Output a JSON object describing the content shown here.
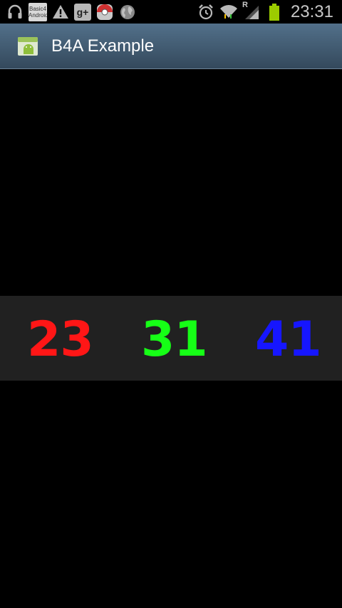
{
  "status_bar": {
    "time": "23:31",
    "notification_icons": [
      "headphones-icon",
      "basic-android-icon",
      "warning-icon",
      "google-plus-icon",
      "app-notification-icon",
      "globe-icon"
    ],
    "basic_android_text_top": "Basic4",
    "basic_android_text_bottom": "Android",
    "google_plus_text": "g+",
    "system_icons": [
      "alarm-icon",
      "wifi-icon",
      "roaming-icon",
      "signal-icon",
      "battery-icon"
    ],
    "roaming_indicator": "R"
  },
  "action_bar": {
    "title": "B4A Example",
    "background_color": "#3f586e"
  },
  "numbers": {
    "first": "23",
    "second": "31",
    "third": "41",
    "first_color": "#ff1616",
    "second_color": "#16ff16",
    "third_color": "#1616ff",
    "panel_color": "#212121"
  }
}
